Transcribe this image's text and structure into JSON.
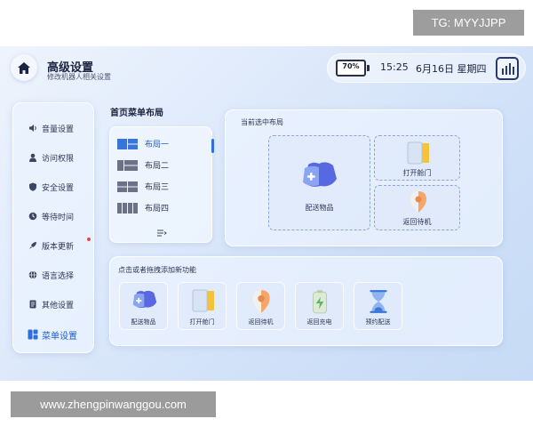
{
  "watermarks": {
    "top": "TG: MYYJJPP",
    "bottom": "www.zhengpinwanggou.com"
  },
  "header": {
    "title": "高级设置",
    "subtitle": "修改机器人相关设置",
    "battery": {
      "text": "70%",
      "level": 0.7
    },
    "time": "15:25",
    "date": "6月16日 星期四"
  },
  "sidebar": {
    "items": [
      {
        "label": "音量设置",
        "icon": "speaker-icon"
      },
      {
        "label": "访问权限",
        "icon": "user-icon"
      },
      {
        "label": "安全设置",
        "icon": "shield-icon"
      },
      {
        "label": "等待时间",
        "icon": "clock-icon"
      },
      {
        "label": "版本更新",
        "icon": "rocket-icon",
        "badge": true
      },
      {
        "label": "语言选择",
        "icon": "globe-icon"
      },
      {
        "label": "其他设置",
        "icon": "document-icon"
      },
      {
        "label": "菜单设置",
        "icon": "menu-grid-icon",
        "active": true
      }
    ]
  },
  "home_menu": {
    "title": "首页菜单布局",
    "layouts": [
      {
        "label": "布局一",
        "active": true
      },
      {
        "label": "布局二"
      },
      {
        "label": "布局三"
      },
      {
        "label": "布局四"
      }
    ]
  },
  "current_layout": {
    "title": "当前选中布局",
    "slots": [
      {
        "label": "配送物品",
        "icon": "delivery-box-icon"
      },
      {
        "label": "打开舱门",
        "icon": "hatch-door-icon"
      },
      {
        "label": "返回待机",
        "icon": "location-pin-icon"
      }
    ]
  },
  "add_functions": {
    "title": "点击或者拖拽添加新功能",
    "items": [
      {
        "label": "配送物品",
        "icon": "delivery-box-icon"
      },
      {
        "label": "打开舱门",
        "icon": "hatch-door-icon"
      },
      {
        "label": "返回待机",
        "icon": "location-pin-icon"
      },
      {
        "label": "返回充电",
        "icon": "battery-charge-icon"
      },
      {
        "label": "预约配送",
        "icon": "hourglass-icon"
      }
    ]
  },
  "colors": {
    "accent": "#2f6ee0",
    "text": "#1b2440",
    "alert": "#e54545"
  }
}
